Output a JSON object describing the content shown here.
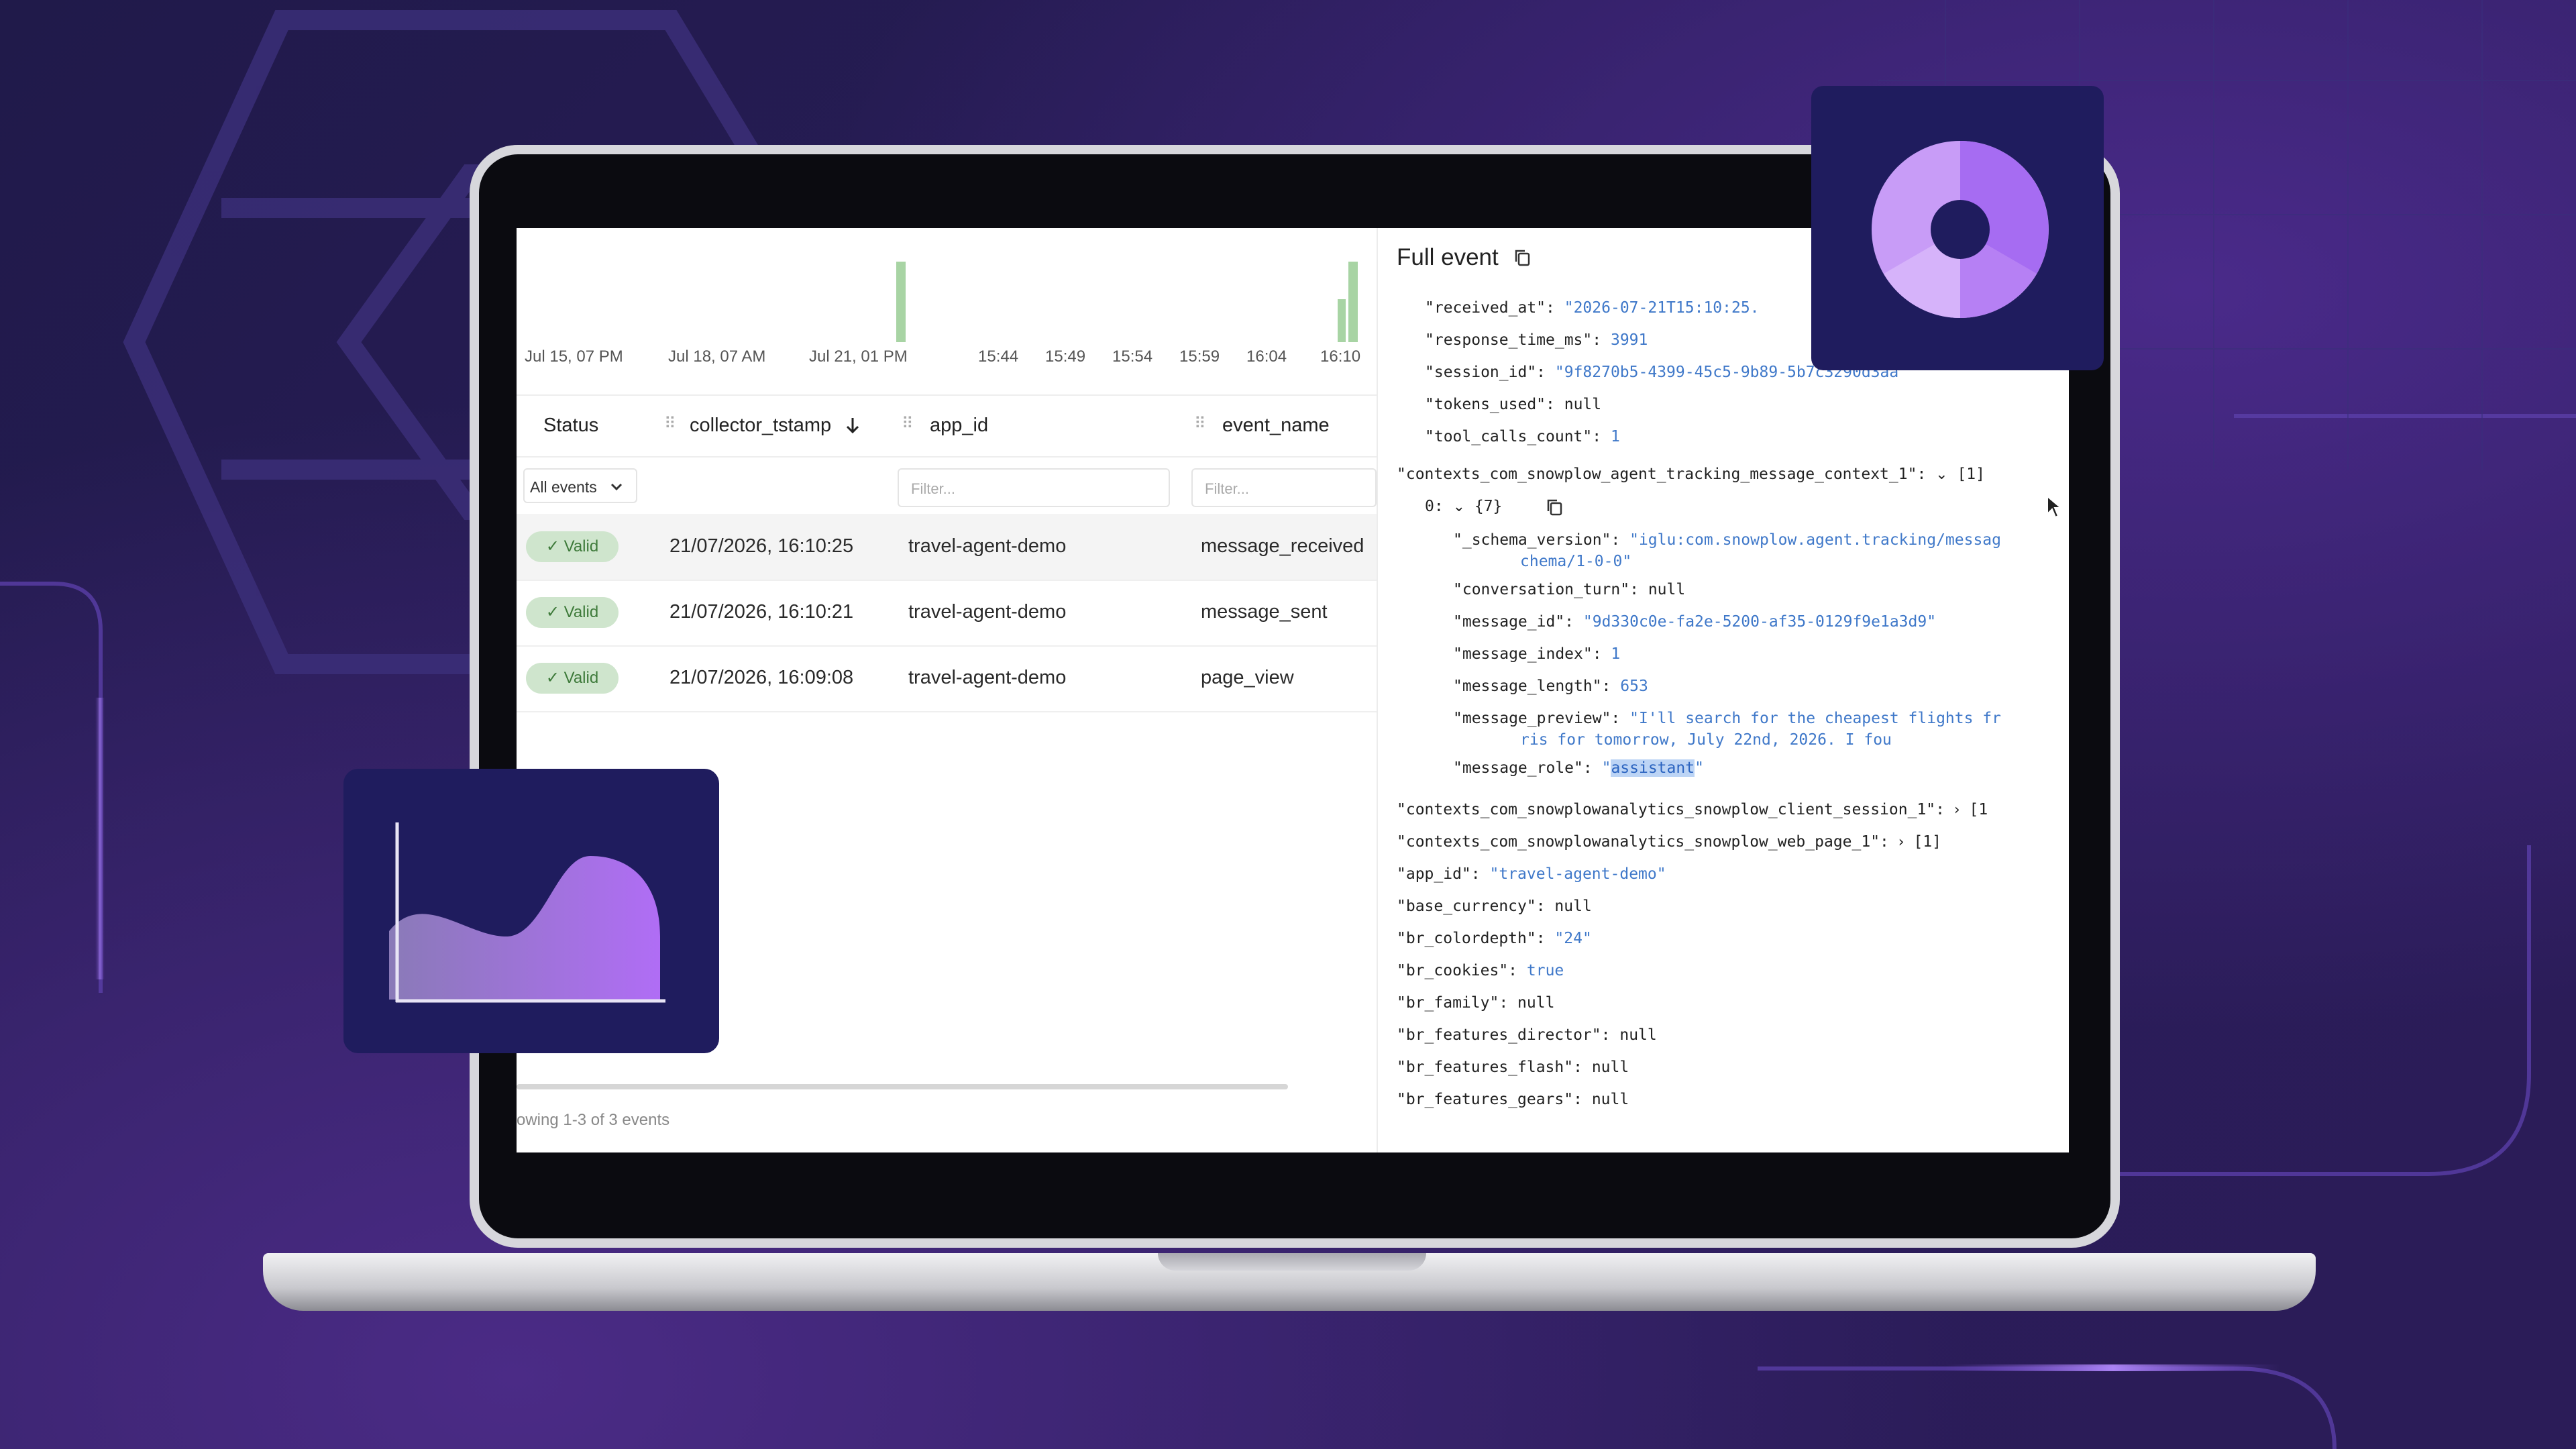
{
  "charts": {
    "left_ticks": [
      "Jul 15, 07 PM",
      "Jul 18, 07 AM",
      "Jul 21, 01 PM"
    ],
    "right_ticks": [
      "15:44",
      "15:49",
      "15:54",
      "15:59",
      "16:04",
      "16:10"
    ],
    "bar_color": "#a8d4a4"
  },
  "table": {
    "columns": [
      "Status",
      "collector_tstamp",
      "app_id",
      "event_name"
    ],
    "sort_icon": "arrow-down-icon",
    "status_filter": "All events",
    "filter_placeholder": "Filter...",
    "rows": [
      {
        "status": "✓ Valid",
        "tstamp": "21/07/2026, 16:10:25",
        "app_id": "travel-agent-demo",
        "event_name": "message_received"
      },
      {
        "status": "✓ Valid",
        "tstamp": "21/07/2026, 16:10:21",
        "app_id": "travel-agent-demo",
        "event_name": "message_sent"
      },
      {
        "status": "✓ Valid",
        "tstamp": "21/07/2026, 16:09:08",
        "app_id": "travel-agent-demo",
        "event_name": "page_view"
      }
    ],
    "footer": "owing 1-3 of 3 events"
  },
  "full_event": {
    "title": "Full event",
    "lines": {
      "received_at_k": "\"received_at\":",
      "received_at_v": "\"2026-07-21T15:10:25.",
      "response_time_k": "\"response_time_ms\":",
      "response_time_v": "3991",
      "session_id_k": "\"session_id\":",
      "session_id_v": "\"9f8270b5-4399-45c5-9b89-5b7c3290d3aa\"",
      "tokens_used_k": "\"tokens_used\":",
      "tokens_used_v": "null",
      "tool_calls_k": "\"tool_calls_count\":",
      "tool_calls_v": "1",
      "ctx_msg_k": "\"contexts_com_snowplow_agent_tracking_message_context_1\":",
      "ctx_msg_v": "[1]",
      "idx0": "0:",
      "obj7": "{7}",
      "schema_k": "\"_schema_version\":",
      "schema_v1": "\"iglu:com.snowplow.agent.tracking/messag",
      "schema_v2": "chema/1-0-0\"",
      "conv_turn_k": "\"conversation_turn\":",
      "conv_turn_v": "null",
      "message_id_k": "\"message_id\":",
      "message_id_v": "\"9d330c0e-fa2e-5200-af35-0129f9e1a3d9\"",
      "message_index_k": "\"message_index\":",
      "message_index_v": "1",
      "message_length_k": "\"message_length\":",
      "message_length_v": "653",
      "message_preview_k": "\"message_preview\":",
      "message_preview_v1": "\"I'll search for the cheapest flights fr",
      "message_preview_v2": "ris for tomorrow, July 22nd, 2026. I fou",
      "message_role_k": "\"message_role\":",
      "message_role_q1": "\"",
      "message_role_v": "assistant",
      "message_role_q2": "\"",
      "ctx_client_k": "\"contexts_com_snowplowanalytics_snowplow_client_session_1\":",
      "ctx_client_v": "[1",
      "ctx_web_k": "\"contexts_com_snowplowanalytics_snowplow_web_page_1\":",
      "ctx_web_v": "[1]",
      "app_id_k": "\"app_id\":",
      "app_id_v": "\"travel-agent-demo\"",
      "base_currency_k": "\"base_currency\":",
      "base_currency_v": "null",
      "br_colordepth_k": "\"br_colordepth\":",
      "br_colordepth_v": "\"24\"",
      "br_cookies_k": "\"br_cookies\":",
      "br_cookies_v": "true",
      "br_family_k": "\"br_family\":",
      "br_family_v": "null",
      "br_director_k": "\"br_features_director\":",
      "br_director_v": "null",
      "br_flash_k": "\"br_features_flash\":",
      "br_flash_v": "null",
      "br_gears_k": "\"br_features_gears\":",
      "br_gears_v": "null"
    }
  },
  "colors": {
    "accent_purple": "#a66cf2",
    "card_navy": "#1f1c5e",
    "valid_green": "#cfe5cd",
    "json_string": "#3f78c9"
  },
  "decor": {
    "donut_icon": "donut-chart-icon",
    "area_icon": "area-chart-icon"
  }
}
